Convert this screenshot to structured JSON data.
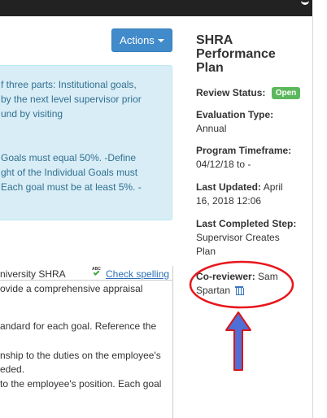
{
  "header": {
    "actions_label": "Actions"
  },
  "info_panel": {
    "lines": [
      "f three parts: Institutional goals,",
      " by the next level supervisor prior",
      "und by visiting",
      "",
      "Goals must equal 50%. -Define",
      "ght of the Individual Goals must",
      "Each goal must be at least 5%. -"
    ]
  },
  "editor": {
    "title": "niversity SHRA",
    "check_spelling": "Check spelling",
    "lines": [
      "ovide a comprehensive appraisal",
      "",
      "andard for each goal. Reference the",
      "",
      "nship to the duties on the employee's",
      "eded.",
      " to the employee's position. Each goal"
    ]
  },
  "sidebar": {
    "title": "SHRA Performance Plan",
    "review_status": {
      "label": "Review Status:",
      "badge": "Open"
    },
    "evaluation_type": {
      "label": "Evaluation Type:",
      "value": "Annual"
    },
    "program_timeframe": {
      "label": "Program Timeframe:",
      "value": "04/12/18 to -"
    },
    "last_updated": {
      "label": "Last Updated:",
      "value_1": "April",
      "value_2": "16, 2018 12:06"
    },
    "last_completed_step": {
      "label": "Last Completed Step:",
      "value_1": "Supervisor Creates",
      "value_2": "Plan"
    },
    "co_reviewer": {
      "label": "Co-reviewer:",
      "value_1": "Sam",
      "value_2": "Spartan"
    }
  },
  "colors": {
    "primary": "#428bca",
    "success": "#5cb85c",
    "info_bg": "#d9edf7",
    "annotation_red": "#e8161b",
    "annotation_arrow": "#4f6fd6"
  },
  "icons": [
    "caret-down-icon",
    "spellcheck-icon",
    "trash-icon",
    "arrow-up-icon"
  ]
}
